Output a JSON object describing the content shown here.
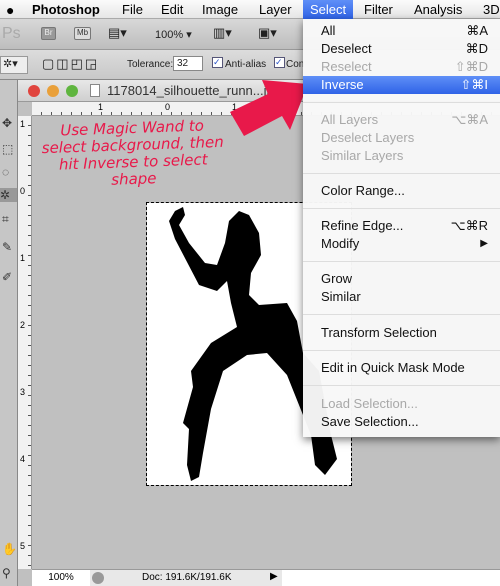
{
  "menubar": {
    "app": "Photoshop",
    "items": [
      "File",
      "Edit",
      "Image",
      "Layer",
      "Select",
      "Filter",
      "Analysis",
      "3D"
    ]
  },
  "appbar": {
    "logo": "Ps",
    "bridge": "Br",
    "minibridge": "Mb",
    "zoom": "100%"
  },
  "options": {
    "tolerance_label": "Tolerance:",
    "tolerance_value": "32",
    "antialias_label": "Anti-alias",
    "antialias_checked": true,
    "contiguous_label": "Con",
    "contiguous_checked": true
  },
  "document": {
    "title": "1178014_silhouette_runn...jpg",
    "hruler": [
      "1",
      "0",
      "1"
    ],
    "vruler": [
      "1",
      "0",
      "1",
      "2",
      "3",
      "4",
      "5"
    ],
    "zoom": "100%",
    "doc_size": "Doc: 191.6K/191.6K"
  },
  "annotation": {
    "text": "Use Magic Wand to select background, then hit Inverse to select shape",
    "color": "#e8194a"
  },
  "select_menu": {
    "items": [
      {
        "label": "All",
        "shortcut": "⌘A"
      },
      {
        "label": "Deselect",
        "shortcut": "⌘D"
      },
      {
        "label": "Reselect",
        "shortcut": "⇧⌘D",
        "disabled": true
      },
      {
        "label": "Inverse",
        "shortcut": "⇧⌘I",
        "highlighted": true
      },
      {
        "label": "All Layers",
        "shortcut": "⌥⌘A",
        "disabled": true
      },
      {
        "label": "Deselect Layers",
        "disabled": true
      },
      {
        "label": "Similar Layers",
        "disabled": true
      },
      {
        "label": "Color Range..."
      },
      {
        "label": "Refine Edge...",
        "shortcut": "⌥⌘R"
      },
      {
        "label": "Modify",
        "shortcut": "▶"
      },
      {
        "label": "Grow"
      },
      {
        "label": "Similar"
      },
      {
        "label": "Transform Selection"
      },
      {
        "label": "Edit in Quick Mask Mode"
      },
      {
        "label": "Load Selection...",
        "disabled": true
      },
      {
        "label": "Save Selection..."
      }
    ]
  },
  "colors": {
    "highlight": "#3a6ff0",
    "accent_pink": "#e8194a"
  }
}
